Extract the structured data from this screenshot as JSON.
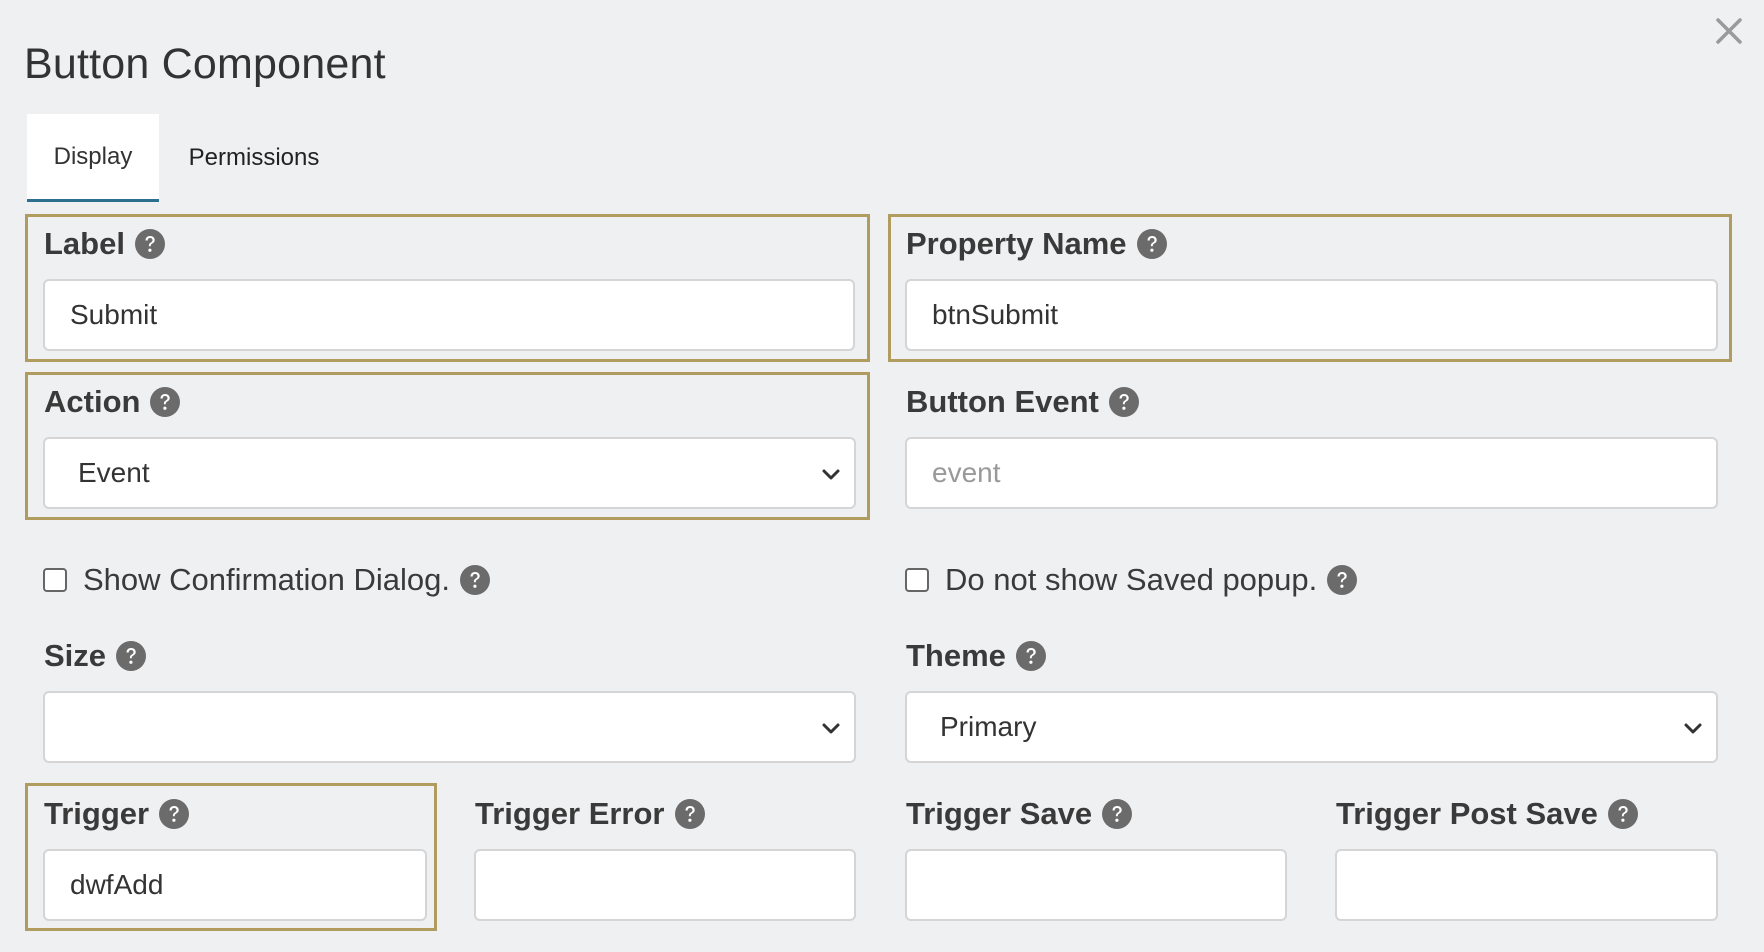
{
  "dialog": {
    "title": "Button Component"
  },
  "tabs": [
    {
      "label": "Display",
      "active": true
    },
    {
      "label": "Permissions",
      "active": false
    }
  ],
  "fields": {
    "label": {
      "label": "Label",
      "value": "Submit"
    },
    "property_name": {
      "label": "Property Name",
      "value": "btnSubmit"
    },
    "action": {
      "label": "Action",
      "value": "Event"
    },
    "button_event": {
      "label": "Button Event",
      "value": "",
      "placeholder": "event"
    },
    "show_confirmation": {
      "label": "Show Confirmation Dialog.",
      "checked": false
    },
    "no_saved_popup": {
      "label": "Do not show Saved popup.",
      "checked": false
    },
    "size": {
      "label": "Size",
      "value": ""
    },
    "theme": {
      "label": "Theme",
      "value": "Primary"
    },
    "trigger": {
      "label": "Trigger",
      "value": "dwfAdd"
    },
    "trigger_error": {
      "label": "Trigger Error",
      "value": ""
    },
    "trigger_save": {
      "label": "Trigger Save",
      "value": ""
    },
    "trigger_post_save": {
      "label": "Trigger Post Save",
      "value": ""
    }
  },
  "icons": {
    "close": "close-icon",
    "help": "question-circle-icon",
    "dropdown": "chevron-down-icon"
  },
  "colors": {
    "background": "#eff0f2",
    "highlight_border": "#b09c5e",
    "active_tab_underline": "#2e6e8e",
    "help_icon": "#6b6b6b"
  }
}
